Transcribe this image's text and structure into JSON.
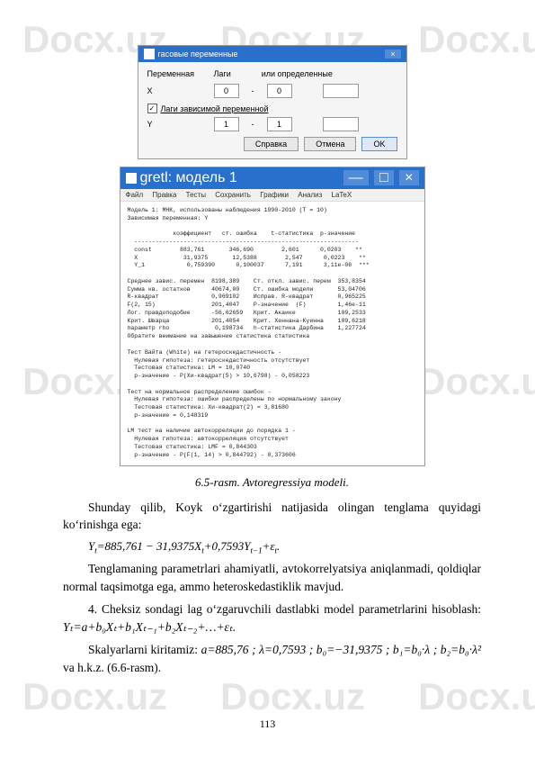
{
  "watermark": "Docx.uz",
  "dialog1": {
    "title": "гасовые переменные",
    "col_persist": "Переменная",
    "col_lags": "Лаги",
    "col_const": "или  определенные",
    "var_x": "X",
    "x_from": "0",
    "x_to": "0",
    "chk_label": "Лаги зависимой переменной",
    "var_y": "Y",
    "y_from": "1",
    "y_to": "1",
    "btn_help": "Справка",
    "btn_cancel": "Отмена",
    "btn_ok": "OK"
  },
  "dialog2": {
    "title": "gretl: модель 1",
    "menu_file": "Файл",
    "menu_edit": "Правка",
    "menu_tests": "Тесты",
    "menu_save": "Сохранить",
    "menu_graphs": "Графики",
    "menu_analysis": "Анализ",
    "menu_latex": "LaTeX",
    "output": "Модель 1: МНК, использованы наблюдения 1990-2010 (T = 10)\nЗависимая переменная: Y\n\n             коэффициент   ст. ошибка    t-статистика  p-значение\n  ----------------------------------------------------------------\n  const        883,761       346,690        2,601      0,0203    **\n  X             31,9375       12,5388        2,547      0,0223    **\n  Y_1            0,759390      0,100037      7,191      3,11e-06  ***\n\nСреднее завис. перемен  8198,389    Ст. откл. завис. перем  353,8354\nСумма кв. остатков      40674,00    Ст. ошибка модели       53,04706\nR-квадрат               0,969102    Исправ. R-квадрат       0,965225\nF(2, 15)                201,4047    P-значение  (F)         1,46e-11\nЛог. правдоподобие      -56,62659   Крит. Акаике            109,2533\nКрит. Шварца            201,4054    Крит. Хеннана-Куинна    109,6218\nпараметр rho             0,198734   h-статистика Дарбина    1,227724\nОбратите внимание на завышение статистика статистика\n\nТест Вайта (White) на гетероскедастичность -\n  Нулевая гипотеза: гетероскедастичность отсутствует\n  Тестовая статистика: LM = 10,0740\n  p-значение - P(Хи-квадрат(5) > 10,6798) - 0,058223\n\nТест на нормальное распределение ошибок -\n  Нулевая гипотеза: ошибки распределены по нормальному закону\n  Тестовая статистика: Хи-квадрат(2) = 3,81680\n  p-значение = 0,148319\n\nLM тест на наличие автокорреляции до порядка 1 -\n  Нулевая гипотеза: автокорреляция отсутствует\n  Тестовая статистика: LMF = 0,844303\n  p-значение - P(F(1, 14) > 0,844792) - 0,373606"
  },
  "caption": "6.5-rasm. Avtoregressiya modeli.",
  "para1": "Shunday qilib, Koyk oʻzgartirishi natijasida olingan tenglama quyidagi koʻrinishga ega:",
  "formula1_lhs": "Y",
  "formula1_sub_t": "t",
  "formula1_eq": "=885,761 − 31,9375",
  "formula1_X": "X",
  "formula1_plus": "+0,7593",
  "formula1_Y": "Y",
  "formula1_sub_tm1": "t−1",
  "formula1_eps": "+ε",
  "formula1_end": ".",
  "para2": "Tenglamaning parametrlari ahamiyatli, avtokorrelyatsiya aniqlanmadi, qoldiqlar normal taqsimotga ega, ammo heteroskedastiklik mavjud.",
  "para3_a": "4. Cheksiz sondagi lag oʻzgaruvchili dastlabki model parametrlarini hisoblash: ",
  "formula2": "Yₜ=a+b₀Xₜ+b₁Xₜ₋₁+b₂Xₜ₋₂+…+εₜ.",
  "para4_a": "Skalyarlarni kiritamiz: ",
  "scalars": "a=885,76 ; λ=0,7593 ; b₀=−31,9375 ; b₁=b₀·λ ; b₂=b₀·λ²",
  "para4_b": " va h.k.z. (6.6-rasm).",
  "page_number": "113"
}
